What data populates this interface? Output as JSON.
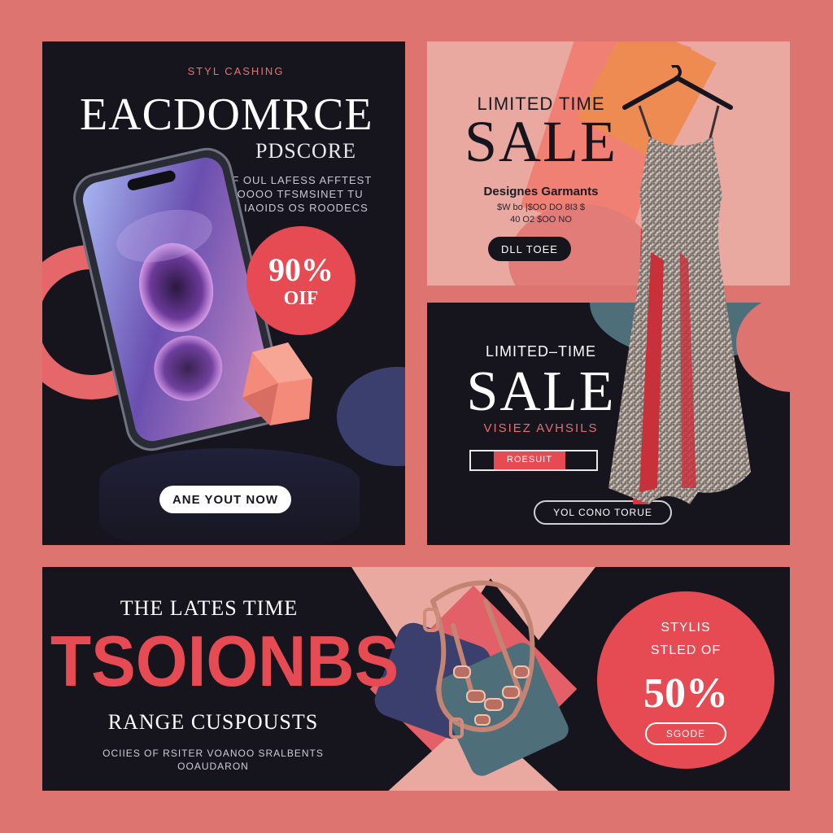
{
  "colors": {
    "background": "#dd7470",
    "dark": "#16151e",
    "accent": "#e64a52",
    "pink": "#e9a9a1",
    "slate": "#4e6e7a",
    "navy": "#3b3f6e",
    "peach": "#f07f74"
  },
  "panel_phone": {
    "eyebrow": "STYL CASHING",
    "title": "EACDOMRCE",
    "subtitle": "PDSCORE",
    "tagline_1": "EYF OUL LAFESS AFFTEST",
    "tagline_2": "POOOO TFSMSINET TU",
    "tagline_3": "IAOIDS OS ROODECS",
    "badge_value": "90%",
    "badge_off": "OIF",
    "cta": "ANE YOUT NOW",
    "icons": [
      "smartphone-icon",
      "gem-shape-icon"
    ]
  },
  "panel_sale_pink": {
    "kicker": "LIMITED TIME",
    "sale": "SALE",
    "heading": "Designes Garmants",
    "line_1": "$W bo  |$OO  DO 8I3 $",
    "line_2": "40  O2   $OO  NO",
    "cta": "DLL TOEE"
  },
  "panel_sale_dark": {
    "kicker": "LIMITED–TIME",
    "sale": "SALE",
    "subtitle": "VISIEZ AVHSILS",
    "input_label": "ROESUIT",
    "cta": "YOL CONO TORUE",
    "icons": [
      "dress-on-hanger-icon"
    ]
  },
  "panel_bottom": {
    "kicker": "THE LATES TIME",
    "headline": "TSOIONBS",
    "range": "RANGE CUSPOUSTS",
    "footer_1": "OCIIES OF RSITER VOANOO SRALBENTS",
    "footer_2": "OOAUDARON",
    "circle_line_1": "STYLIS",
    "circle_line_2": "STLED OF",
    "circle_value": "50%",
    "circle_cta": "SGODE",
    "icons": [
      "necklace-icon"
    ]
  }
}
